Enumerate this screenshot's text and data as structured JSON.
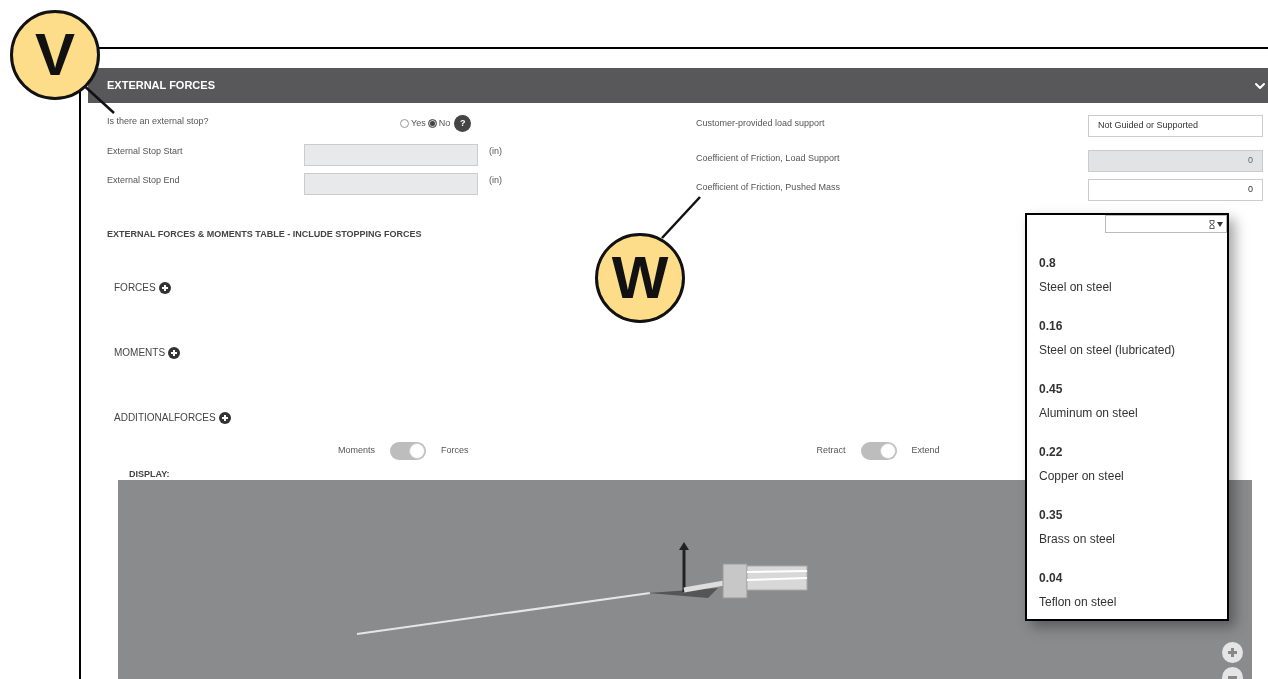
{
  "callouts": [
    {
      "label": "V"
    },
    {
      "label": "W"
    }
  ],
  "panel": {
    "title": "EXTERNAL FORCES",
    "expanded": true
  },
  "external_stop": {
    "label": "Is there an external stop?",
    "options": [
      {
        "label": "Yes",
        "selected": false
      },
      {
        "label": "No",
        "selected": true
      }
    ],
    "help": "?"
  },
  "stop_fields": [
    {
      "label": "External Stop Start",
      "unit": "(in)",
      "disabled": true
    },
    {
      "label": "External Stop End",
      "unit": "(in)",
      "disabled": true
    }
  ],
  "right_fields": [
    {
      "label": "Customer-provided load support",
      "value": "Not Guided or Supported",
      "kind": "select",
      "disabled": false
    },
    {
      "label": "Coefficient of Friction, Load Support",
      "value": "0",
      "kind": "number",
      "disabled": true
    },
    {
      "label": "Coefficient of Friction, Pushed Mass",
      "value": "0",
      "kind": "number",
      "disabled": false
    }
  ],
  "table_heading": "EXTERNAL FORCES & MOMENTS TABLE - INCLUDE STOPPING FORCES",
  "sections": [
    {
      "label": "FORCES"
    },
    {
      "label": "MOMENTS"
    },
    {
      "label": "ADDITIONALFORCES"
    }
  ],
  "toggles": [
    {
      "off_label": "Moments",
      "on_label": "Forces",
      "on": true
    },
    {
      "off_label": "Retract",
      "on_label": "Extend",
      "on": true
    }
  ],
  "display_label": "DISPLAY:",
  "dropdown": {
    "options": [
      {
        "value": "0.8",
        "label": "Steel on steel"
      },
      {
        "value": "0.16",
        "label": "Steel on steel (lubricated)"
      },
      {
        "value": "0.45",
        "label": "Aluminum on steel"
      },
      {
        "value": "0.22",
        "label": "Copper on steel"
      },
      {
        "value": "0.35",
        "label": "Brass on steel"
      },
      {
        "value": "0.04",
        "label": "Teflon on steel"
      }
    ]
  }
}
